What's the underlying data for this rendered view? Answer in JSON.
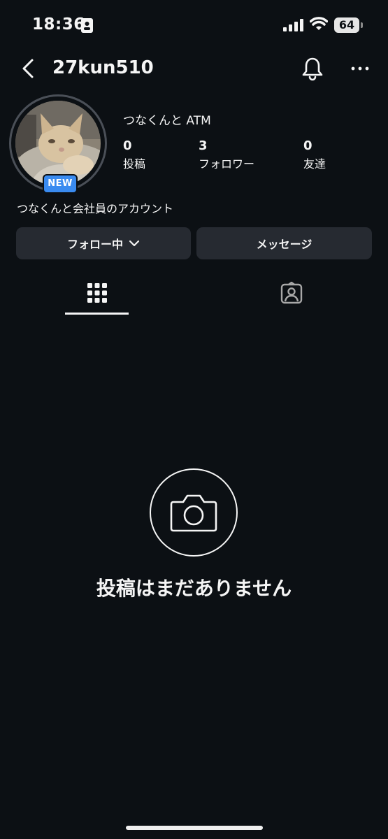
{
  "status_bar": {
    "time": "18:36",
    "battery": "64"
  },
  "header": {
    "username": "27kun510"
  },
  "profile": {
    "display_name": "つなくんと ATM",
    "badge": "NEW",
    "bio": "つなくんと会社員のアカウント",
    "stats": [
      {
        "value": "0",
        "label": "投稿"
      },
      {
        "value": "3",
        "label": "フォロワー"
      },
      {
        "value": "0",
        "label": "友達"
      }
    ]
  },
  "actions": {
    "following_label": "フォロー中",
    "message_label": "メッセージ"
  },
  "tabs": {
    "active": "grid"
  },
  "empty_state": {
    "text": "投稿はまだありません"
  },
  "colors": {
    "background": "#0c1014",
    "button": "#262a31",
    "badge": "#3a8bf0"
  }
}
